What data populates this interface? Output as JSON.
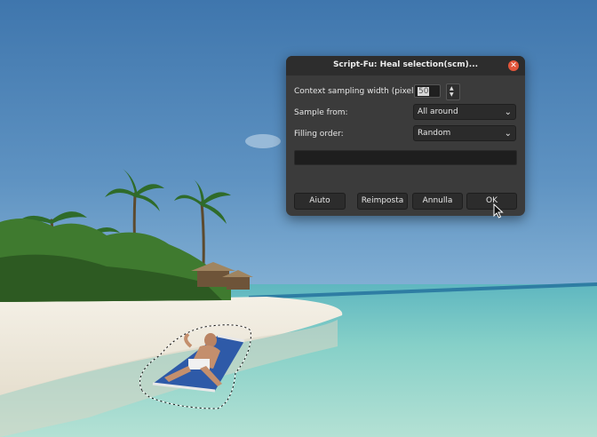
{
  "dialog": {
    "title": "Script-Fu: Heal selection(scm)...",
    "close_glyph": "✕",
    "fields": {
      "context_width_label": "Context sampling width (pixels):",
      "context_width_value": "50",
      "sample_from_label": "Sample from:",
      "sample_from_value": "All around",
      "filling_order_label": "Filling order:",
      "filling_order_value": "Random"
    },
    "progress": 0,
    "buttons": {
      "help": "Aiuto",
      "reset": "Reimposta",
      "cancel": "Annulla",
      "ok": "OK"
    }
  },
  "icons": {
    "close": "close-icon",
    "chevron": "chevron-down-icon",
    "spin_up": "arrow-up-icon",
    "spin_down": "arrow-down-icon",
    "cursor": "mouse-pointer-icon"
  },
  "colors": {
    "dialog_bg": "#3b3b3b",
    "titlebar_bg": "#2d2d2d",
    "close_button": "#e2553a"
  }
}
